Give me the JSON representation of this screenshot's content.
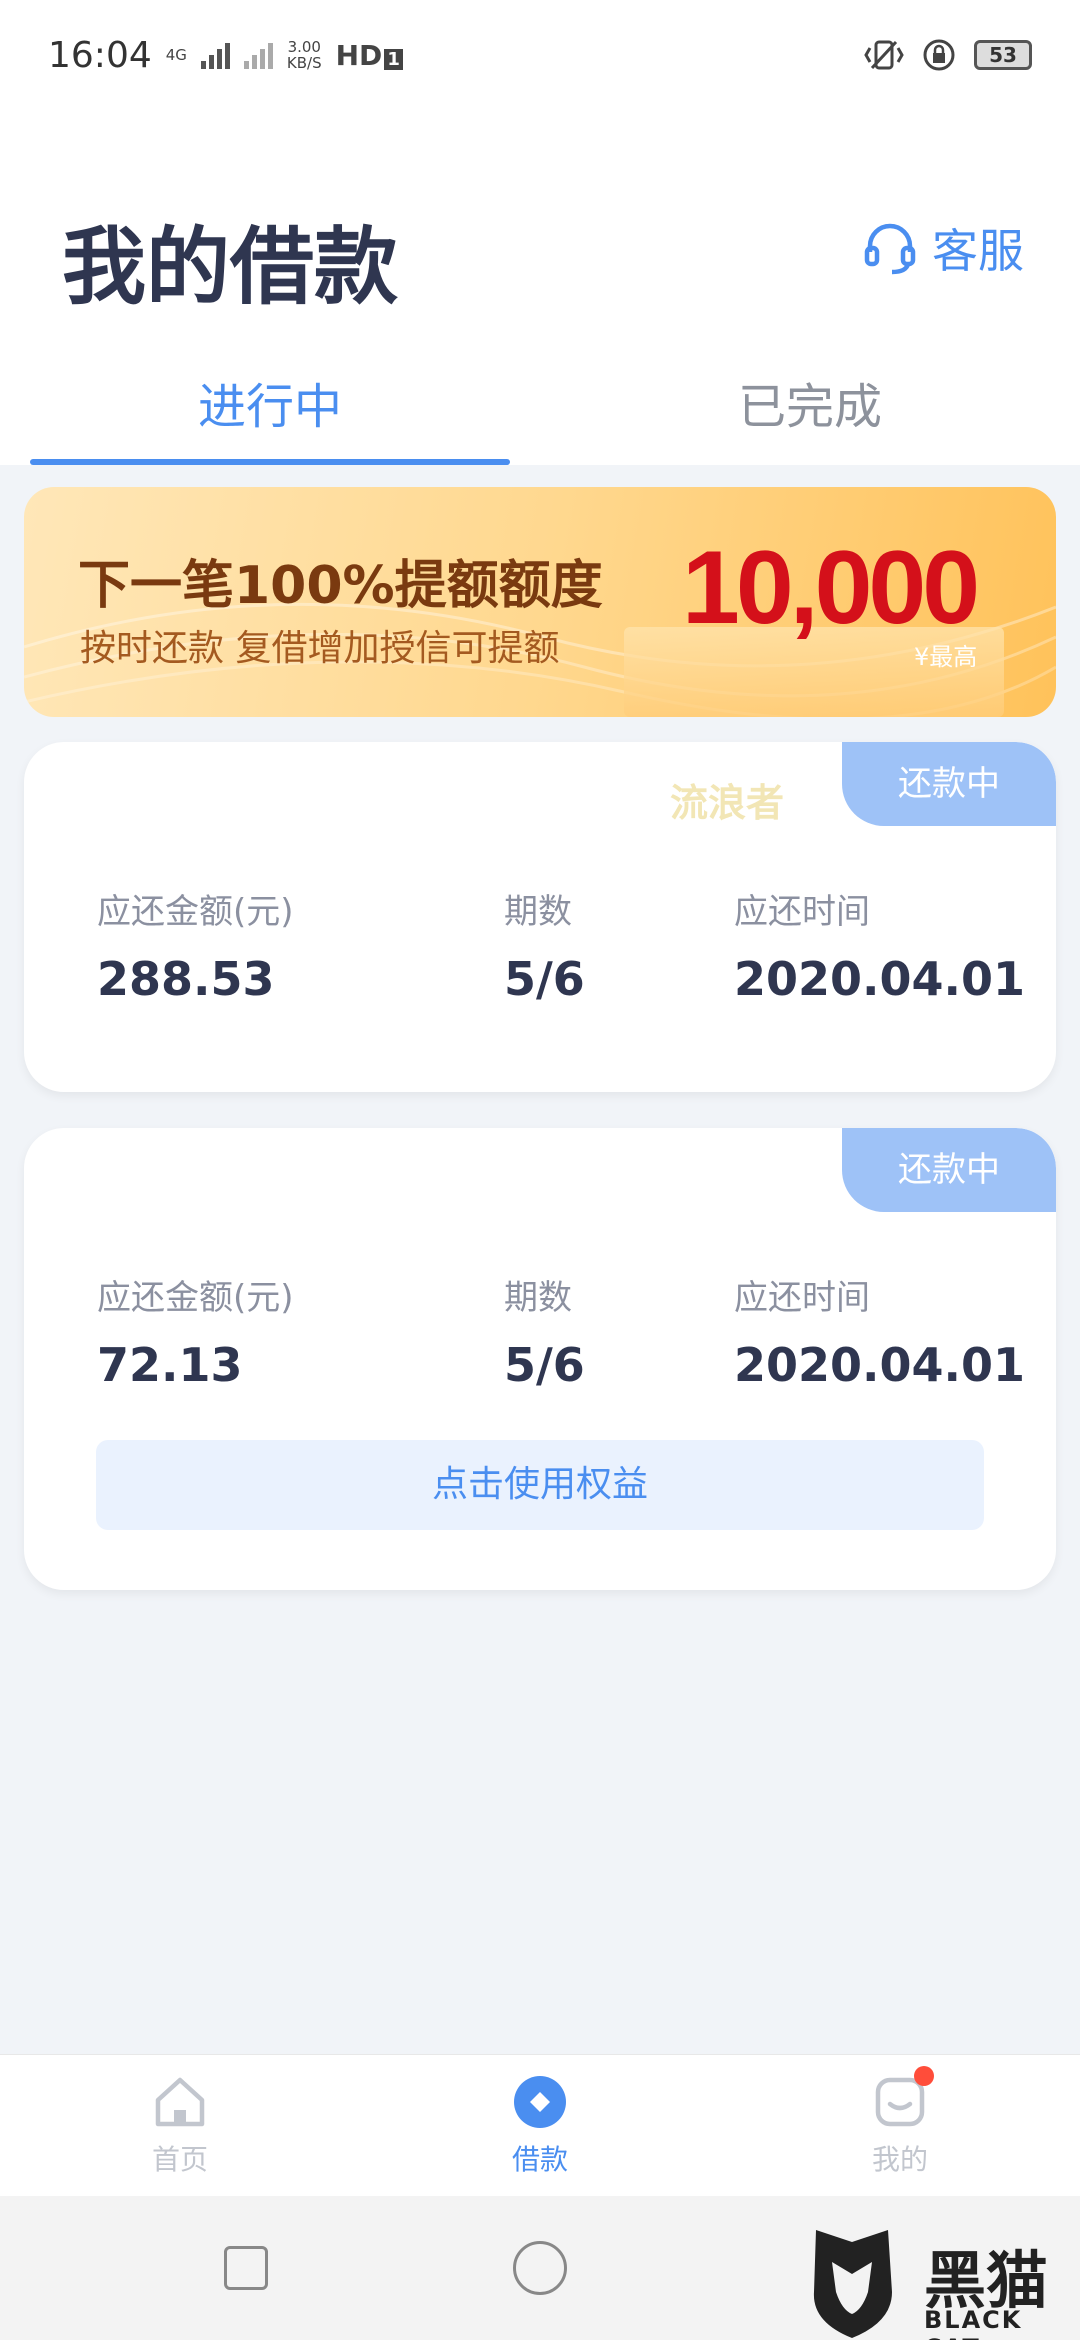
{
  "status_bar": {
    "time": "16:04",
    "network": "4G",
    "speed_value": "3.00",
    "speed_unit": "KB/S",
    "hd": "HD",
    "hd_sub": "1",
    "battery": "53"
  },
  "header": {
    "title": "我的借款",
    "service_label": "客服"
  },
  "tabs": [
    {
      "label": "进行中",
      "active": true
    },
    {
      "label": "已完成",
      "active": false
    }
  ],
  "banner": {
    "title": "下一笔100%提额额度",
    "subtitle": "按时还款  复借增加授信可提额",
    "amount": "10,000",
    "amount_note": "¥最高"
  },
  "watermark": "流浪者",
  "loans": [
    {
      "status": "还款中",
      "amount_label": "应还金额(元)",
      "amount": "288.53",
      "period_label": "期数",
      "period": "5/6",
      "date_label": "应还时间",
      "date": "2020.04.01"
    },
    {
      "status": "还款中",
      "amount_label": "应还金额(元)",
      "amount": "72.13",
      "period_label": "期数",
      "period": "5/6",
      "date_label": "应还时间",
      "date": "2020.04.01",
      "action": "点击使用权益"
    }
  ],
  "bottom_nav": [
    {
      "label": "首页",
      "icon": "home-icon"
    },
    {
      "label": "借款",
      "icon": "loan-icon",
      "active": true
    },
    {
      "label": "我的",
      "icon": "profile-icon",
      "badge": true
    }
  ],
  "brand": {
    "name": "黑猫",
    "name_en": "BLACK CAT"
  },
  "colors": {
    "accent": "#4a8ef0",
    "title": "#2f3650",
    "badge": "#9ec2f7",
    "banner_amount": "#d4101a"
  }
}
